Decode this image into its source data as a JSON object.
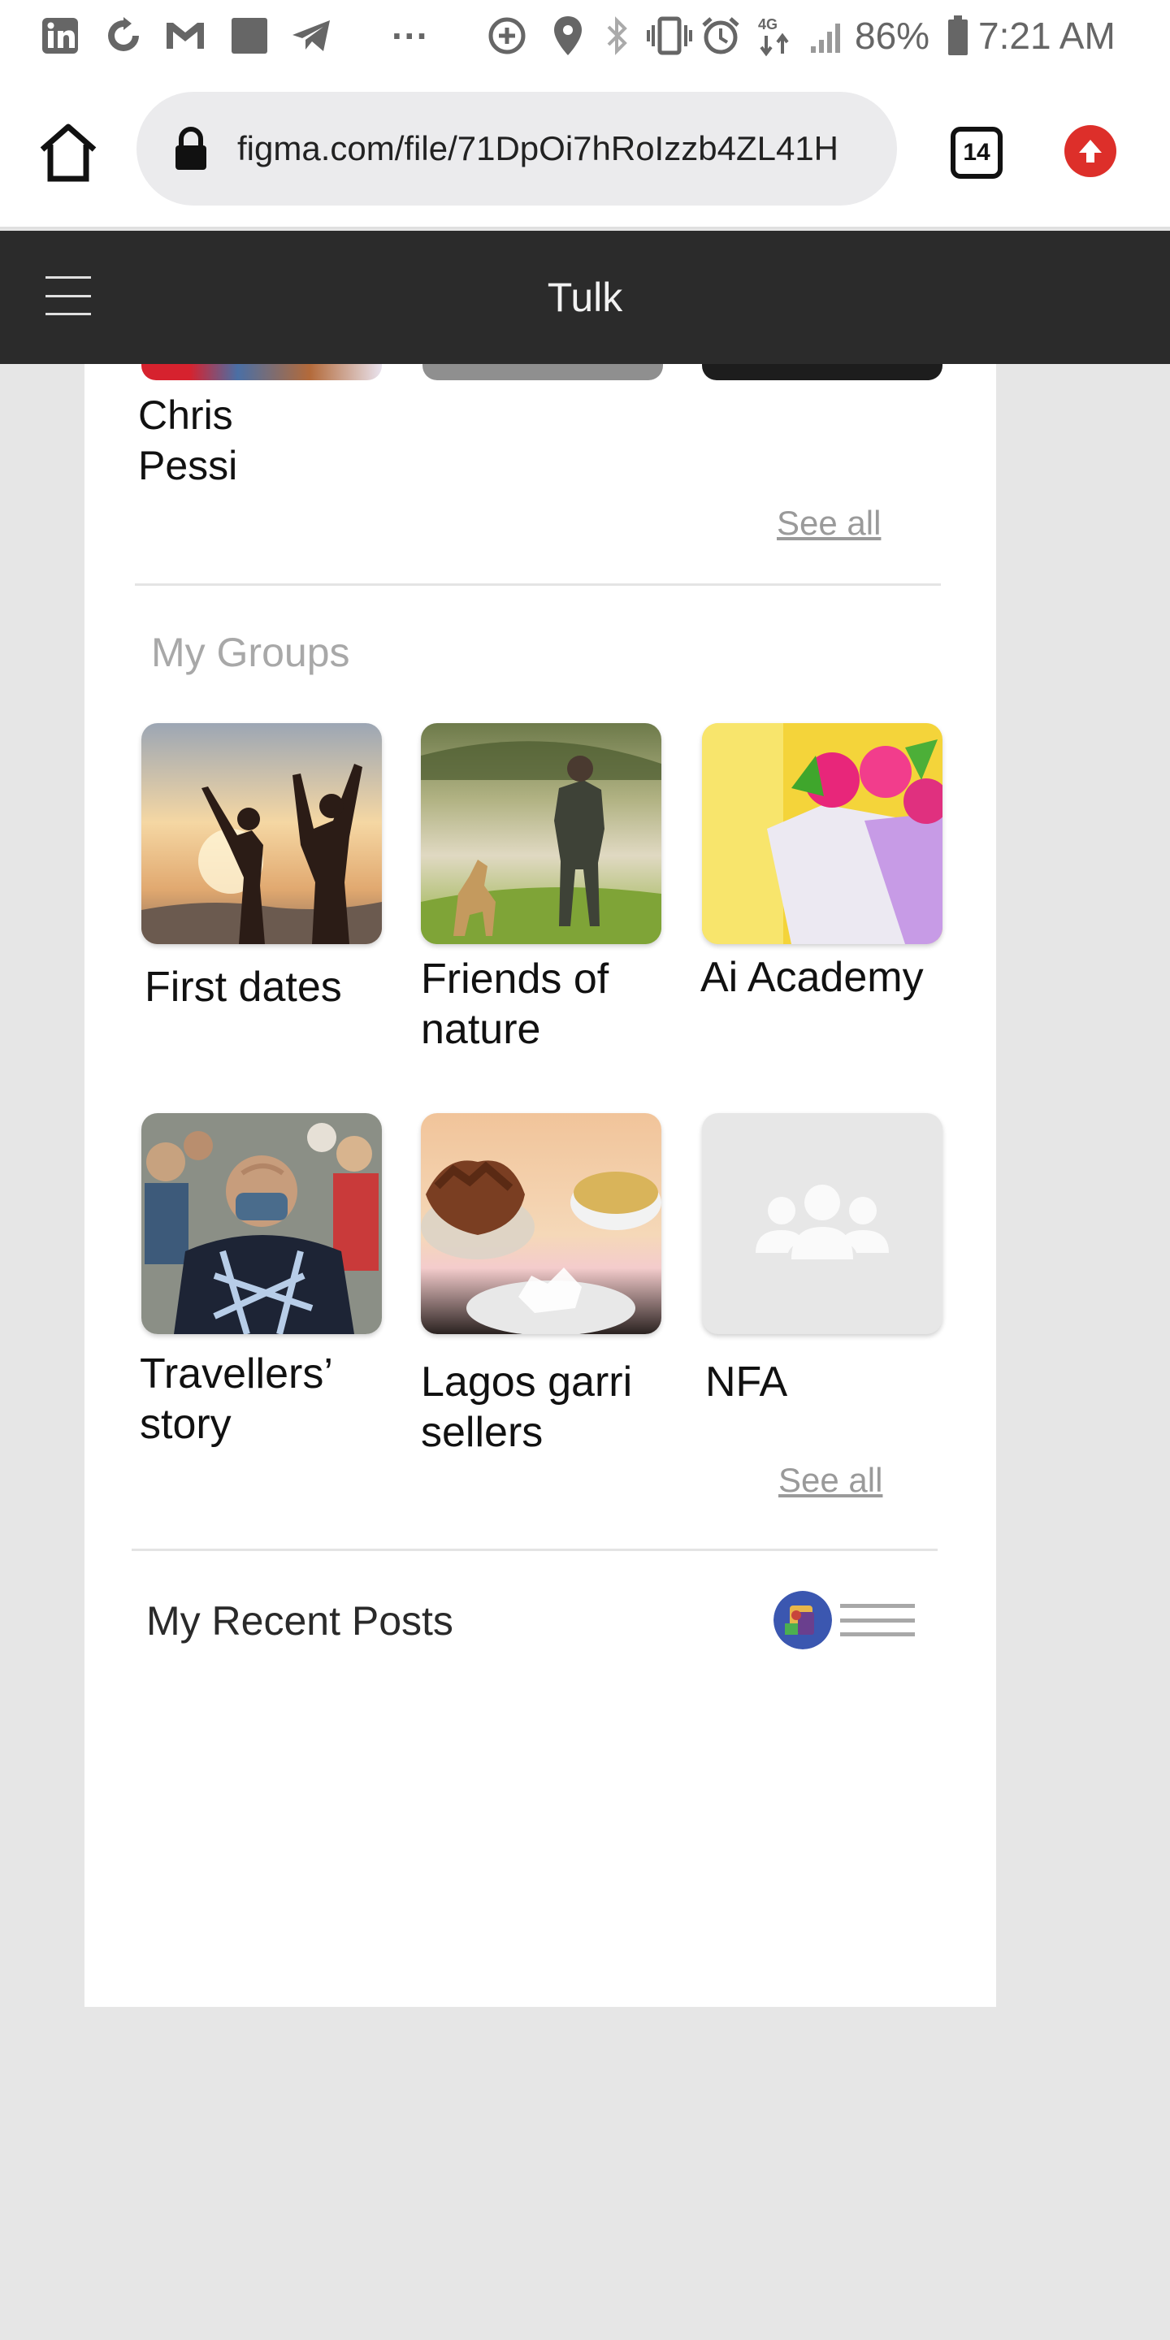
{
  "status_bar": {
    "battery_percent": "86%",
    "time": "7:21 AM",
    "network": "4G",
    "overflow": "···",
    "icons": [
      "linkedin-icon",
      "sync-icon",
      "gmail-icon",
      "square-icon",
      "telegram-icon",
      "data-saver-icon",
      "location-icon",
      "bluetooth-icon",
      "vibrate-icon",
      "alarm-icon",
      "network-icon",
      "signal-icon",
      "battery-icon"
    ]
  },
  "browser": {
    "url": "figma.com/file/71DpOi7hRoIzzb4ZL41H",
    "tab_count": "14",
    "icons": [
      "home-icon",
      "lock-icon",
      "tabs-icon",
      "update-icon"
    ]
  },
  "header": {
    "title": "Tulk",
    "menu_icon": "hamburger-menu-icon"
  },
  "friends": {
    "visible_name": "Chris\nPessi",
    "see_all": "See all"
  },
  "groups": {
    "title": "My Groups",
    "items": [
      {
        "label": "First dates"
      },
      {
        "label": "Friends of\nnature"
      },
      {
        "label": "Ai Academy"
      },
      {
        "label": "Travellers’\nstory"
      },
      {
        "label": "Lagos garri\nsellers"
      },
      {
        "label": "NFA"
      }
    ],
    "see_all": "See all",
    "placeholder_icon": "people-group-icon"
  },
  "recent_posts": {
    "title": "My Recent Posts",
    "icons": [
      "avatar",
      "list-view-icon"
    ]
  },
  "colors": {
    "header_bg": "#2b2b2b",
    "page_bg": "#e6e6e6",
    "update_red": "#dd2f2a",
    "muted_text": "#9a9a9a"
  }
}
